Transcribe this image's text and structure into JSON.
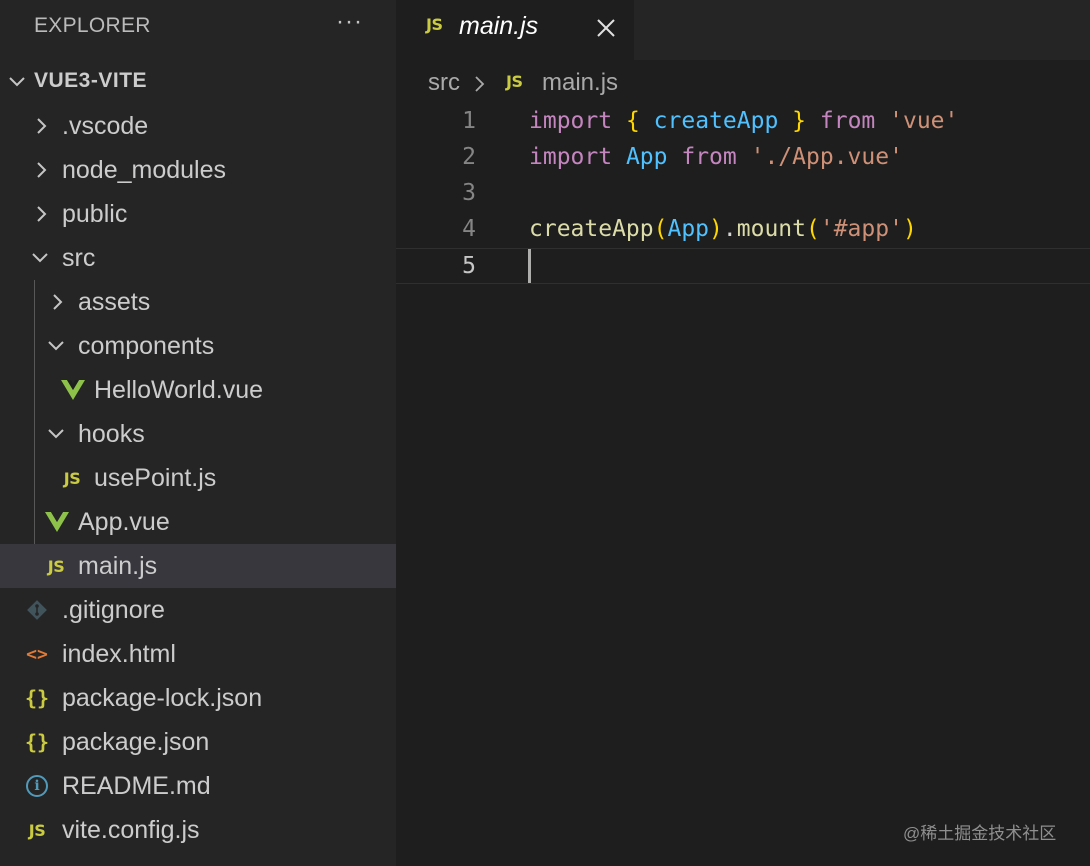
{
  "explorer": {
    "title": "EXPLORER",
    "more_label": "···",
    "root": {
      "label": "VUE3-VITE",
      "expanded": true
    }
  },
  "tree": [
    {
      "label": ".vscode",
      "icon": "chevron-right-icon",
      "kind": "folder",
      "expanded": false
    },
    {
      "label": "node_modules",
      "icon": "chevron-right-icon",
      "kind": "folder",
      "expanded": false
    },
    {
      "label": "public",
      "icon": "chevron-right-icon",
      "kind": "folder",
      "expanded": false
    },
    {
      "label": "src",
      "icon": "chevron-down-icon",
      "kind": "folder",
      "expanded": true
    },
    {
      "label": "assets",
      "icon": "chevron-right-icon",
      "kind": "folder",
      "expanded": false
    },
    {
      "label": "components",
      "icon": "chevron-down-icon",
      "kind": "folder",
      "expanded": true
    },
    {
      "label": "HelloWorld.vue",
      "icon": "vue-icon",
      "kind": "file"
    },
    {
      "label": "hooks",
      "icon": "chevron-down-icon",
      "kind": "folder",
      "expanded": true
    },
    {
      "label": "usePoint.js",
      "icon": "js-icon",
      "icon_text": "JS",
      "kind": "file"
    },
    {
      "label": "App.vue",
      "icon": "vue-icon",
      "kind": "file"
    },
    {
      "label": "main.js",
      "icon": "js-icon",
      "icon_text": "JS",
      "kind": "file",
      "selected": true
    },
    {
      "label": ".gitignore",
      "icon": "git-icon",
      "kind": "file"
    },
    {
      "label": "index.html",
      "icon": "html-icon",
      "icon_text": "<>",
      "kind": "file"
    },
    {
      "label": "package-lock.json",
      "icon": "json-icon",
      "icon_text": "{}",
      "kind": "file"
    },
    {
      "label": "package.json",
      "icon": "json-icon",
      "icon_text": "{}",
      "kind": "file"
    },
    {
      "label": "README.md",
      "icon": "info-icon",
      "icon_text": "i",
      "kind": "file"
    },
    {
      "label": "vite.config.js",
      "icon": "js-icon",
      "icon_text": "JS",
      "kind": "file"
    }
  ],
  "editor": {
    "tab": {
      "icon_text": "JS",
      "label": "main.js",
      "close_icon": "close-icon"
    },
    "breadcrumb": {
      "folder": "src",
      "icon_text": "JS",
      "file": "main.js"
    },
    "lines": [
      {
        "number": "1",
        "tokens": [
          {
            "text": "import",
            "color": "#c586c0"
          },
          {
            "text": " ",
            "color": "#d4d4d4"
          },
          {
            "text": "{",
            "color": "#ffd700"
          },
          {
            "text": " ",
            "color": "#d4d4d4"
          },
          {
            "text": "createApp",
            "color": "#4fc1ff"
          },
          {
            "text": " ",
            "color": "#d4d4d4"
          },
          {
            "text": "}",
            "color": "#ffd700"
          },
          {
            "text": " ",
            "color": "#d4d4d4"
          },
          {
            "text": "from",
            "color": "#c586c0"
          },
          {
            "text": " ",
            "color": "#d4d4d4"
          },
          {
            "text": "'vue'",
            "color": "#ce9178"
          }
        ]
      },
      {
        "number": "2",
        "tokens": [
          {
            "text": "import",
            "color": "#c586c0"
          },
          {
            "text": " ",
            "color": "#d4d4d4"
          },
          {
            "text": "App",
            "color": "#4fc1ff"
          },
          {
            "text": " ",
            "color": "#d4d4d4"
          },
          {
            "text": "from",
            "color": "#c586c0"
          },
          {
            "text": " ",
            "color": "#d4d4d4"
          },
          {
            "text": "'./App.vue'",
            "color": "#ce9178"
          }
        ]
      },
      {
        "number": "3",
        "tokens": []
      },
      {
        "number": "4",
        "tokens": [
          {
            "text": "createApp",
            "color": "#dcdcaa"
          },
          {
            "text": "(",
            "color": "#ffd700"
          },
          {
            "text": "App",
            "color": "#4fc1ff"
          },
          {
            "text": ")",
            "color": "#ffd700"
          },
          {
            "text": ".",
            "color": "#d4d4d4"
          },
          {
            "text": "mount",
            "color": "#dcdcaa"
          },
          {
            "text": "(",
            "color": "#ffd700"
          },
          {
            "text": "'#app'",
            "color": "#ce9178"
          },
          {
            "text": ")",
            "color": "#ffd700"
          }
        ]
      },
      {
        "number": "5",
        "tokens": [],
        "current": true
      }
    ]
  },
  "watermark": "@稀土掘金技术社区",
  "colors": {
    "js": "#cbcb41",
    "vue": "#8dc149",
    "html": "#e37933",
    "git": "#41535b",
    "info": "#519aba",
    "selection": "#37373d"
  }
}
